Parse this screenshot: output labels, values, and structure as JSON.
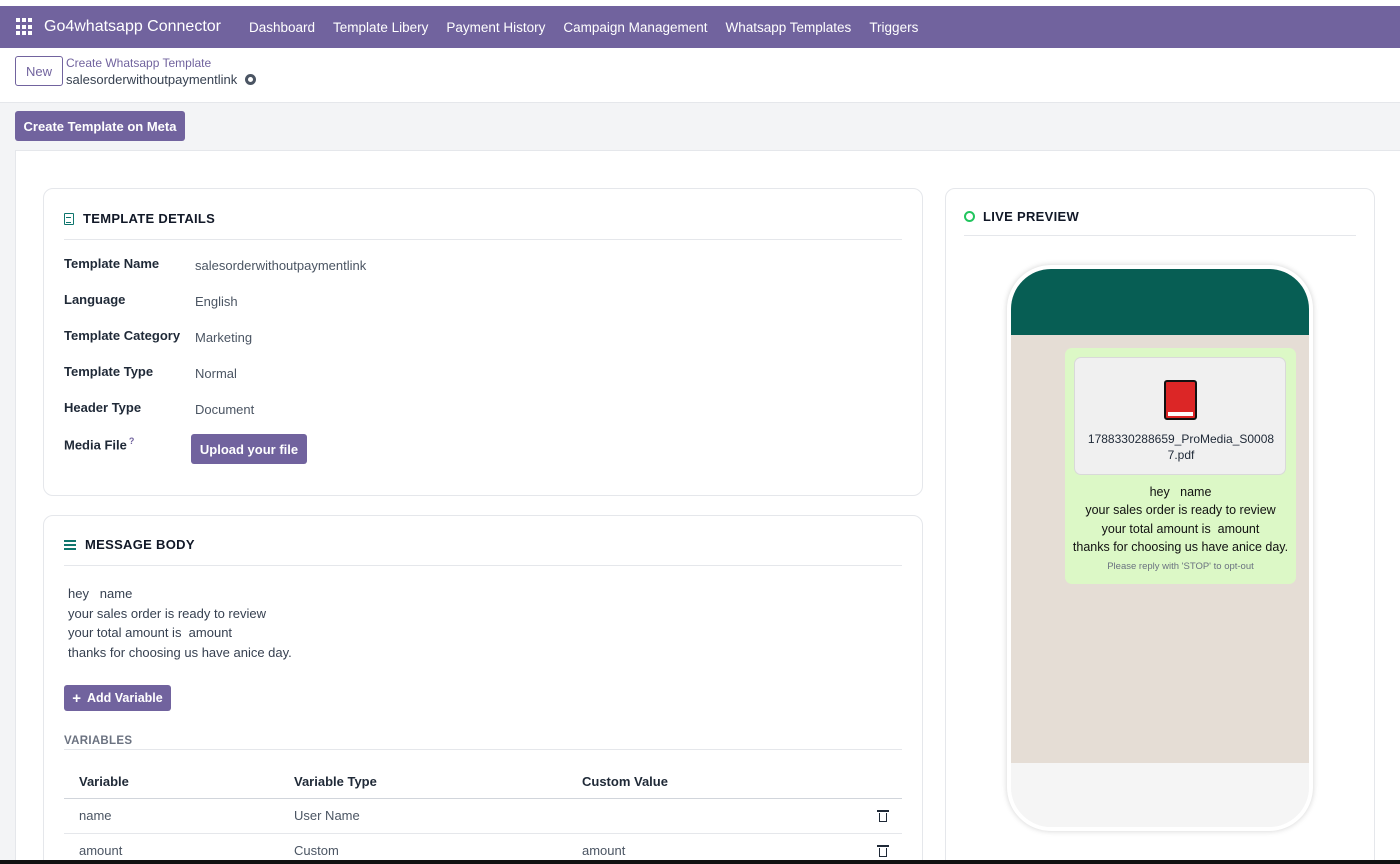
{
  "navbar": {
    "brand": "Go4whatsapp Connector",
    "items": [
      "Dashboard",
      "Template Libery",
      "Payment History",
      "Campaign Management",
      "Whatsapp Templates",
      "Triggers"
    ]
  },
  "control_panel": {
    "new_label": "New",
    "breadcrumb": "Create Whatsapp Template",
    "record_title": "salesorderwithoutpaymentlink"
  },
  "status_bar": {
    "create_label": "Create Template on Meta"
  },
  "details": {
    "title": "TEMPLATE DETAILS",
    "fields": [
      {
        "label": "Template Name",
        "value": "salesorderwithoutpaymentlink"
      },
      {
        "label": "Language",
        "value": "English"
      },
      {
        "label": "Template Category",
        "value": "Marketing"
      },
      {
        "label": "Template Type",
        "value": "Normal"
      },
      {
        "label": "Header Type",
        "value": "Document"
      }
    ],
    "media_label": "Media File",
    "media_help": "?",
    "upload_label": "Upload your file"
  },
  "message": {
    "title": "MESSAGE BODY",
    "body": "hey   name\nyour sales order is ready to review\nyour total amount is  amount\nthanks for choosing us have anice day.",
    "add_variable_label": "Add Variable",
    "variables_title": "VARIABLES",
    "columns": [
      "Variable",
      "Variable Type",
      "Custom Value"
    ],
    "rows": [
      {
        "variable": "name",
        "type": "User Name",
        "custom": ""
      },
      {
        "variable": "amount",
        "type": "Custom",
        "custom": "amount"
      }
    ]
  },
  "preview": {
    "title": "LIVE PREVIEW",
    "doc_name": "1788330288659_ProMedia_S00087.pdf",
    "text": "hey   name\nyour sales order is ready to review\nyour total amount is  amount\nthanks for choosing us have anice day.",
    "optout": "Please reply with 'STOP' to opt-out"
  },
  "colors": {
    "brand": "#71639e",
    "whatsapp_header": "#075e54",
    "bubble": "#dcf8c6",
    "accent_icon": "#0f766e"
  },
  "icons": [
    "apps-grid-icon",
    "gear-icon",
    "document-icon",
    "list-icon",
    "plus-icon",
    "trash-icon",
    "whatsapp-icon",
    "pdf-book-icon"
  ]
}
